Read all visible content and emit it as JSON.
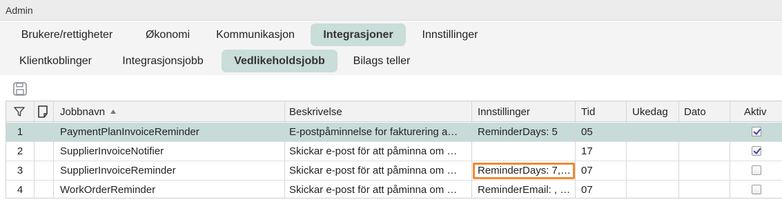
{
  "window": {
    "title": "Admin"
  },
  "tabs_primary": [
    {
      "label": "Brukere/rettigheter",
      "active": false
    },
    {
      "label": "Økonomi",
      "active": false
    },
    {
      "label": "Kommunikasjon",
      "active": false
    },
    {
      "label": "Integrasjoner",
      "active": true
    },
    {
      "label": "Innstillinger",
      "active": false
    }
  ],
  "tabs_secondary": [
    {
      "label": "Klientkoblinger",
      "active": false
    },
    {
      "label": "Integrasjonsjobb",
      "active": false
    },
    {
      "label": "Vedlikeholdsjobb",
      "active": true
    },
    {
      "label": "Bilags teller",
      "active": false
    }
  ],
  "toolbar": {
    "save_icon": "save-icon"
  },
  "grid": {
    "columns": {
      "filter_icon": "filter-icon",
      "note_icon": "note-icon",
      "name": "Jobbnavn",
      "sort_icon": "sort-ascending-icon",
      "description": "Beskrivelse",
      "settings": "Innstillinger",
      "time": "Tid",
      "weekday": "Ukedag",
      "date": "Dato",
      "active": "Aktiv"
    },
    "rows": [
      {
        "num": "1",
        "name": "PaymentPlanInvoiceReminder",
        "description": "E-postpåminnelse for fakturering a…",
        "settings": "ReminderDays: 5",
        "time": "05",
        "weekday": "",
        "date": "",
        "active": true,
        "selected": true
      },
      {
        "num": "2",
        "name": "SupplierInvoiceNotifier",
        "description": "Skickar e-post för att påminna om …",
        "settings": "",
        "time": "17",
        "weekday": "",
        "date": "",
        "active": true,
        "selected": false
      },
      {
        "num": "3",
        "name": "SupplierInvoiceReminder",
        "description": "Skickar e-post för att påminna om …",
        "settings": "ReminderDays: 7,…",
        "time": "07",
        "weekday": "",
        "date": "",
        "active": false,
        "selected": false
      },
      {
        "num": "4",
        "name": "WorkOrderReminder",
        "description": "Skickar e-post för att påminna om …",
        "settings": "ReminderEmail: , …",
        "time": "07",
        "weekday": "",
        "date": "",
        "active": false,
        "selected": false
      }
    ]
  },
  "colors": {
    "accent": "#c9ddd9",
    "highlight": "#f08a32",
    "check": "#3d3daa"
  }
}
